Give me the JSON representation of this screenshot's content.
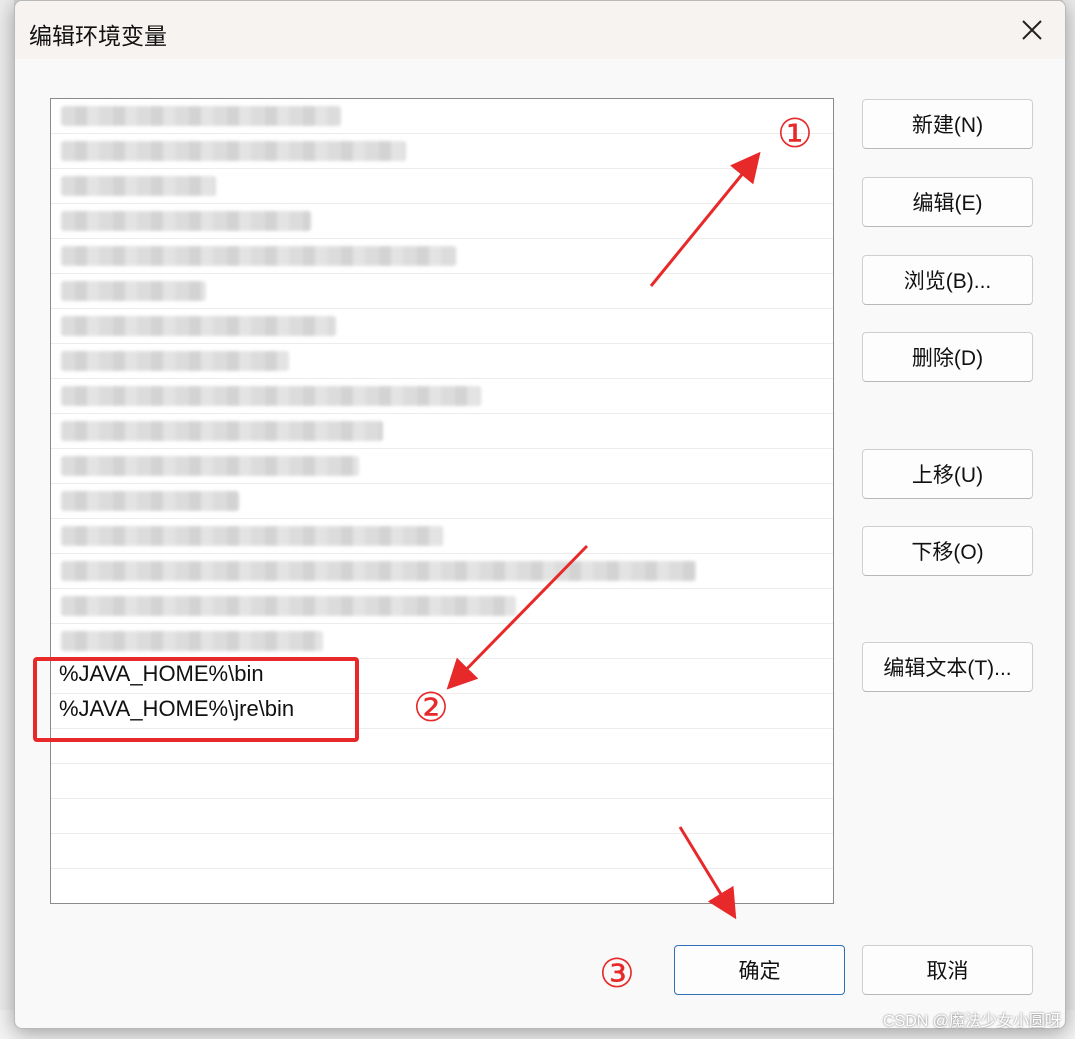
{
  "window": {
    "title": "编辑环境变量"
  },
  "list": {
    "items": [
      {
        "text": "",
        "blurred": true,
        "w": 280
      },
      {
        "text": "",
        "blurred": true,
        "w": 345
      },
      {
        "text": "",
        "blurred": true,
        "w": 155
      },
      {
        "text": "",
        "blurred": true,
        "w": 250
      },
      {
        "text": "",
        "blurred": true,
        "w": 395
      },
      {
        "text": "",
        "blurred": true,
        "w": 145
      },
      {
        "text": "",
        "blurred": true,
        "w": 275
      },
      {
        "text": "",
        "blurred": true,
        "w": 228
      },
      {
        "text": "",
        "blurred": true,
        "w": 420
      },
      {
        "text": "",
        "blurred": true,
        "w": 322
      },
      {
        "text": "",
        "blurred": true,
        "w": 298
      },
      {
        "text": "",
        "blurred": true,
        "w": 178
      },
      {
        "text": "",
        "blurred": true,
        "w": 382
      },
      {
        "text": "",
        "blurred": true,
        "w": 635
      },
      {
        "text": "",
        "blurred": true,
        "w": 455
      },
      {
        "text": "",
        "blurred": true,
        "w": 262
      },
      {
        "text": "%JAVA_HOME%\\bin",
        "blurred": false
      },
      {
        "text": "%JAVA_HOME%\\jre\\bin",
        "blurred": false
      },
      {
        "text": "",
        "blurred": false
      },
      {
        "text": "",
        "blurred": false
      },
      {
        "text": "",
        "blurred": false
      },
      {
        "text": "",
        "blurred": false
      },
      {
        "text": "",
        "blurred": false
      }
    ]
  },
  "buttons": {
    "new": "新建(N)",
    "edit": "编辑(E)",
    "browse": "浏览(B)...",
    "delete": "删除(D)",
    "move_up": "上移(U)",
    "move_down": "下移(O)",
    "edit_text": "编辑文本(T)...",
    "ok": "确定",
    "cancel": "取消"
  },
  "annotations": {
    "step1": "①",
    "step2": "②",
    "step3": "③",
    "color": "#e8292a"
  },
  "watermark": "CSDN @魔法少女小圆呀"
}
